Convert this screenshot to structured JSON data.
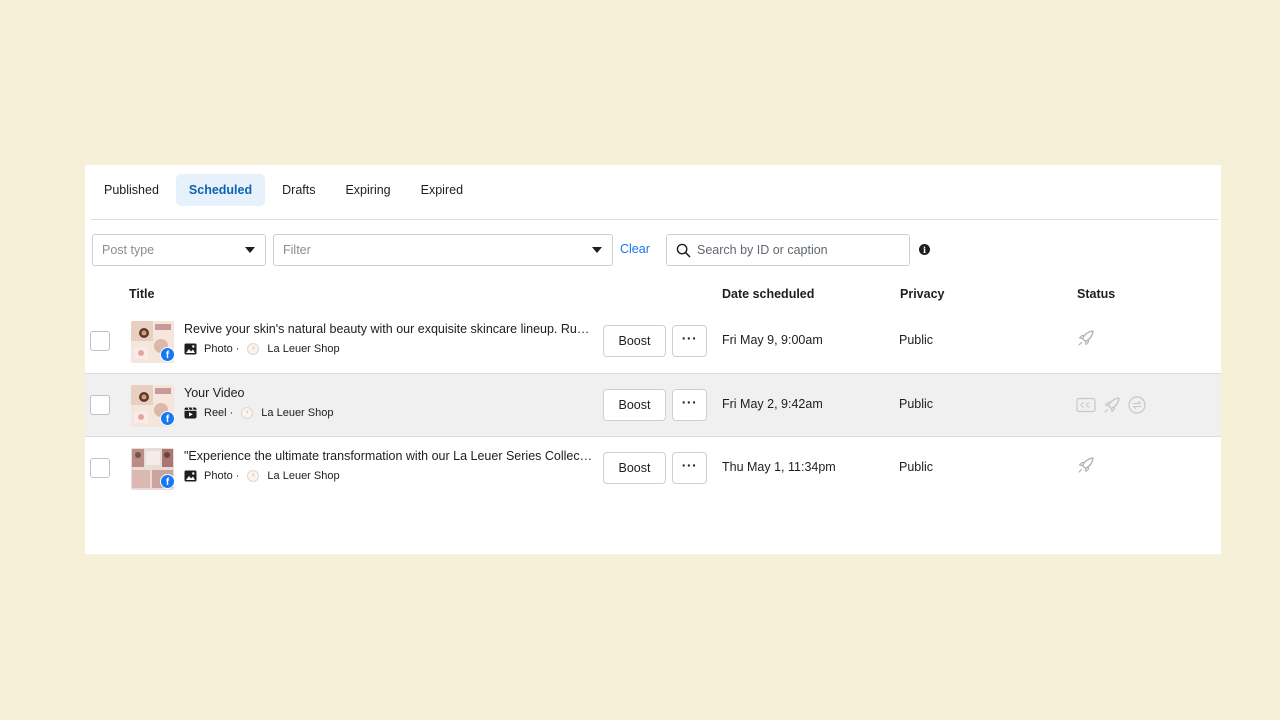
{
  "tabs": [
    {
      "label": "Published",
      "active": false
    },
    {
      "label": "Scheduled",
      "active": true
    },
    {
      "label": "Drafts",
      "active": false
    },
    {
      "label": "Expiring",
      "active": false
    },
    {
      "label": "Expired",
      "active": false
    }
  ],
  "filters": {
    "post_type_placeholder": "Post type",
    "filter_placeholder": "Filter",
    "clear_label": "Clear",
    "search_placeholder": "Search by ID or caption"
  },
  "table": {
    "headers": {
      "title": "Title",
      "date": "Date scheduled",
      "privacy": "Privacy",
      "status": "Status"
    },
    "rows": [
      {
        "title": "Revive your skin's natural beauty with our exquisite skincare lineup. Rush to get yours today!",
        "type": "Photo",
        "page": "La Leuer Shop",
        "boost_label": "Boost",
        "more_label": "···",
        "date": "Fri May 9, 9:00am",
        "privacy": "Public",
        "status_icons": [
          "rocket-icon"
        ]
      },
      {
        "title": "Your Video",
        "type": "Reel",
        "page": "La Leuer Shop",
        "boost_label": "Boost",
        "more_label": "···",
        "date": "Fri May 2, 9:42am",
        "privacy": "Public",
        "status_icons": [
          "captions-icon",
          "rocket-icon",
          "crosspost-icon"
        ]
      },
      {
        "title": "\"Experience the ultimate transformation with our La Leuer Series Collection...",
        "type": "Photo",
        "page": "La Leuer Shop",
        "boost_label": "Boost",
        "more_label": "···",
        "date": "Thu May 1, 11:34pm",
        "privacy": "Public",
        "status_icons": [
          "rocket-icon"
        ]
      }
    ]
  },
  "colors": {
    "background": "#f7f0d9",
    "accent": "#1877f2",
    "active_tab_bg": "#e7f1fb",
    "active_tab_text": "#0a64b3",
    "highlight_row": "#f0f0f0"
  }
}
